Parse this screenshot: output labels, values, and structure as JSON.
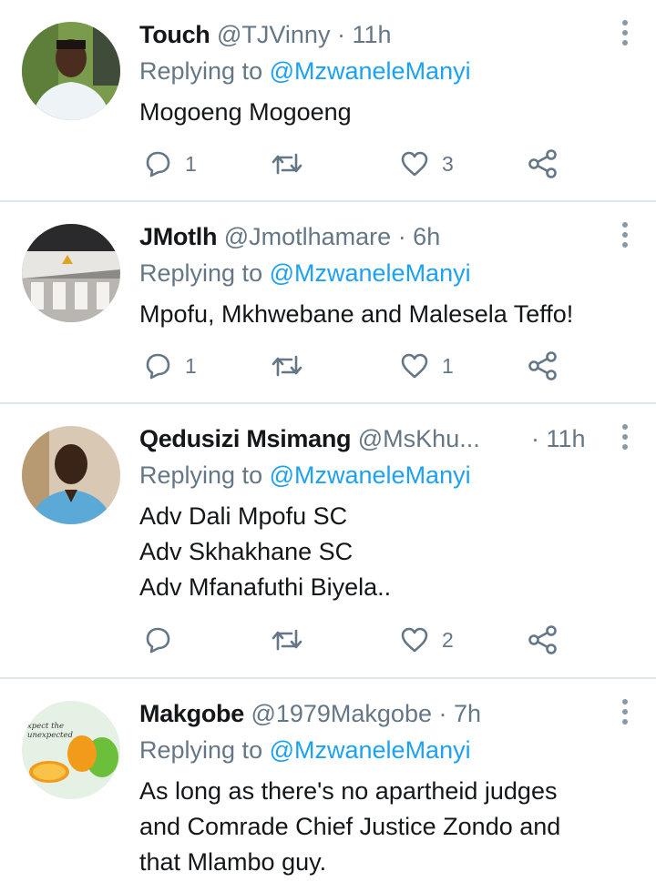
{
  "tweets": [
    {
      "name": "Touch",
      "handle": "@TJVinny",
      "time": "· 11h",
      "replying_label": "Replying to",
      "replying_to": "@MzwaneleManyi",
      "lines": [
        "Mogoeng Mogoeng"
      ],
      "reply_count": "1",
      "retweet_count": "",
      "like_count": "3"
    },
    {
      "name": "JMotlh",
      "handle": "@Jmotlhamare",
      "time": "· 6h",
      "replying_label": "Replying to",
      "replying_to": "@MzwaneleManyi",
      "lines": [
        "Mpofu, Mkhwebane and Malesela Teffo!"
      ],
      "reply_count": "1",
      "retweet_count": "",
      "like_count": "1"
    },
    {
      "name": "Qedusizi Msimang",
      "handle": "@MsKhu...",
      "time": "· 11h",
      "replying_label": "Replying to",
      "replying_to": "@MzwaneleManyi",
      "lines": [
        "Adv Dali Mpofu SC",
        "Adv Skhakhane SC",
        "Adv Mfanafuthi Biyela.."
      ],
      "reply_count": "",
      "retweet_count": "",
      "like_count": "2"
    },
    {
      "name": "Makgobe",
      "handle": "@1979Makgobe",
      "time": "· 7h",
      "replying_label": "Replying to",
      "replying_to": "@MzwaneleManyi",
      "lines": [
        "As long as there's no apartheid judges",
        "and Comrade Chief Justice Zondo and",
        "that Mlambo guy."
      ],
      "avatar_text": [
        "xpect the",
        "unexpected"
      ]
    }
  ],
  "icons": {
    "reply": "reply-icon",
    "retweet": "retweet-icon",
    "like": "heart-icon",
    "share": "share-icon",
    "more": "more-vertical-icon"
  },
  "colors": {
    "mention": "#1da1f2",
    "secondary": "#657786",
    "divider": "#e1e8ed"
  }
}
